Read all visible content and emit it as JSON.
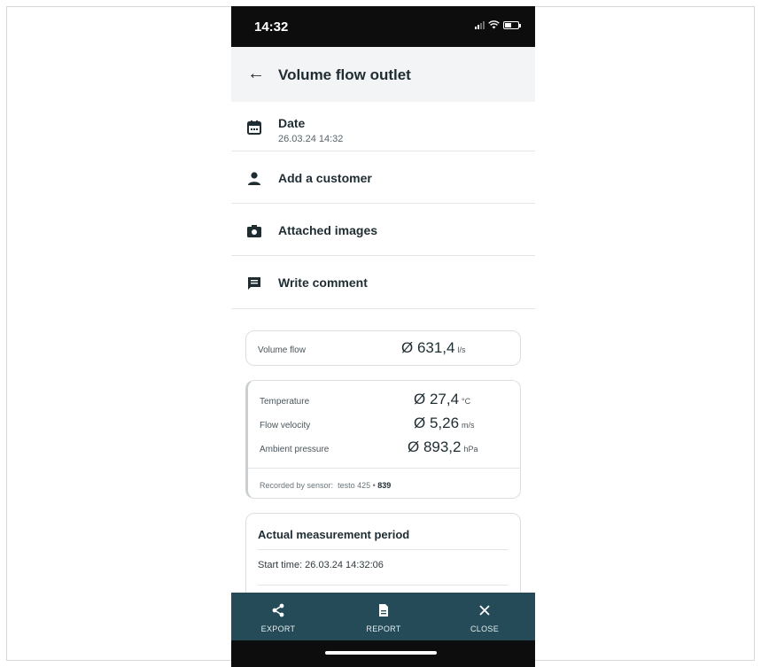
{
  "status_bar": {
    "time": "14:32"
  },
  "header": {
    "title": "Volume flow outlet"
  },
  "date": {
    "label": "Date",
    "value": "26.03.24 14:32"
  },
  "rows": {
    "customer": "Add a customer",
    "images": "Attached images",
    "comment": "Write comment"
  },
  "volume_flow": {
    "label": "Volume flow",
    "value": "Ø 631,4",
    "unit": "l/s"
  },
  "measurements": [
    {
      "label": "Temperature",
      "value": "Ø 27,4",
      "unit": "°C"
    },
    {
      "label": "Flow velocity",
      "value": "Ø 5,26",
      "unit": "m/s"
    },
    {
      "label": "Ambient pressure",
      "value": "Ø 893,2",
      "unit": "hPa"
    }
  ],
  "sensor": {
    "prefix": "Recorded by sensor:",
    "model": "testo 425 •",
    "serial": "839"
  },
  "period": {
    "title": "Actual measurement period",
    "start": "Start time: 26.03.24 14:32:06"
  },
  "toolbar": {
    "export": "EXPORT",
    "report": "REPORT",
    "close": "CLOSE"
  },
  "colors": {
    "toolbar_bg": "#244b57",
    "header_bg": "#f2f4f5",
    "status_bg": "#0d0d0d"
  }
}
